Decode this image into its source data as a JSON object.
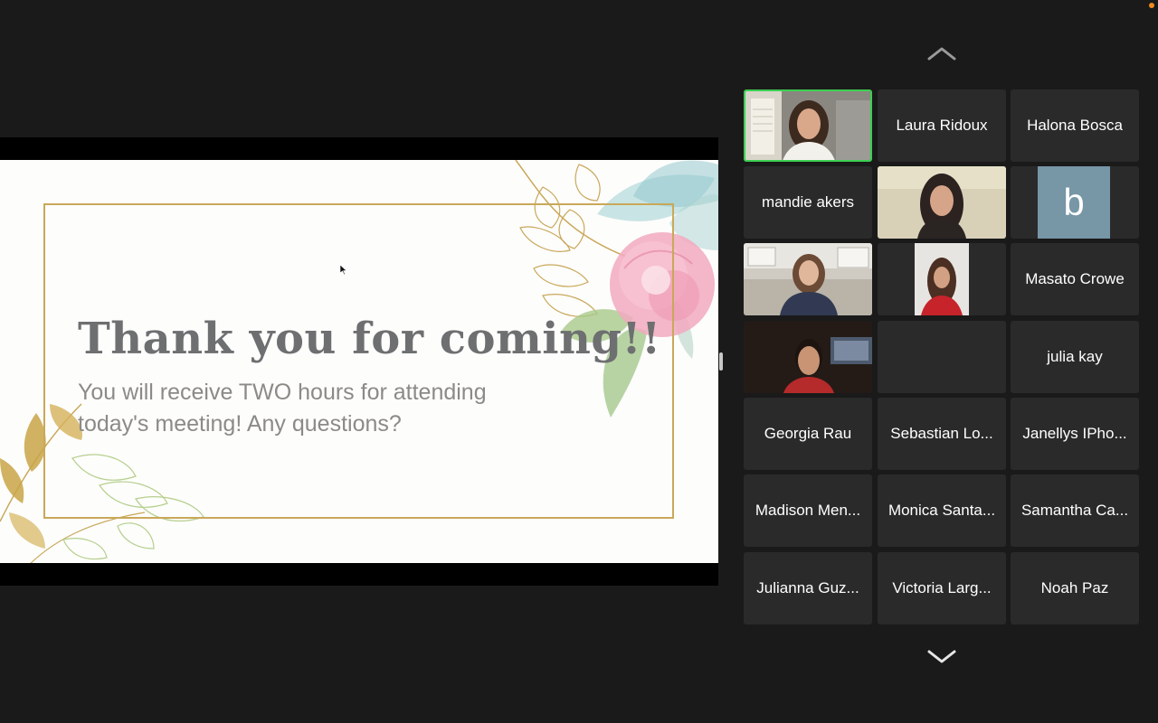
{
  "slide": {
    "title": "Thank you for coming!!",
    "body": "You will receive TWO hours for attending today's meeting! Any questions?"
  },
  "gallery": {
    "participants": [
      {
        "name": "",
        "video": true
      },
      {
        "name": "Laura Ridoux",
        "video": false
      },
      {
        "name": "Halona Bosca",
        "video": false
      },
      {
        "name": "mandie akers",
        "video": false
      },
      {
        "name": "",
        "video": true
      },
      {
        "name": "",
        "video": false,
        "avatar_letter": "b"
      },
      {
        "name": "",
        "video": true
      },
      {
        "name": "",
        "video": true
      },
      {
        "name": "Masato Crowe",
        "video": false
      },
      {
        "name": "",
        "video": true
      },
      {
        "name": "",
        "video": false
      },
      {
        "name": "julia kay",
        "video": false
      },
      {
        "name": "Georgia Rau",
        "video": false
      },
      {
        "name": "Sebastian Lo...",
        "video": false
      },
      {
        "name": "Janellys IPho...",
        "video": false
      },
      {
        "name": "Madison Men...",
        "video": false
      },
      {
        "name": "Monica Santa...",
        "video": false
      },
      {
        "name": "Samantha Ca...",
        "video": false
      },
      {
        "name": "Julianna Guz...",
        "video": false
      },
      {
        "name": "Victoria Larg...",
        "video": false
      },
      {
        "name": "Noah Paz",
        "video": false
      }
    ]
  },
  "colors": {
    "background": "#1a1a1a",
    "tile": "#2a2a2a",
    "active_speaker": "#3ccf52",
    "slide_frame": "#c9a85a",
    "avatar": "#7796a6"
  },
  "icons": {
    "nav_up": "chevron-up-icon",
    "nav_down": "chevron-down-icon",
    "cursor": "mouse-cursor-icon"
  }
}
